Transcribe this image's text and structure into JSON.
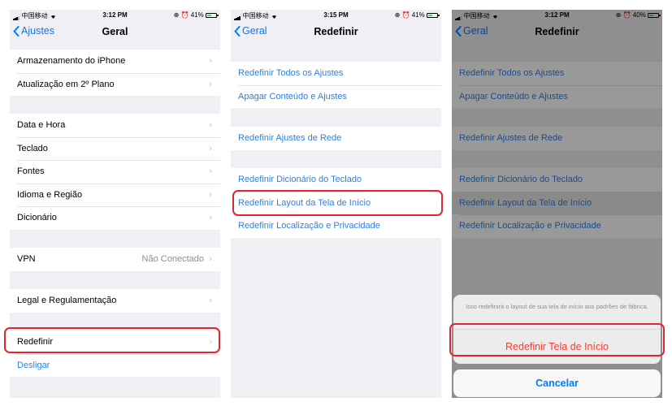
{
  "screen1": {
    "status": {
      "carrier": "中国移动",
      "time": "3:12 PM",
      "battery": "41%"
    },
    "nav": {
      "back_label": "Ajustes",
      "title": "Geral"
    },
    "rows": [
      {
        "label": "Armazenamento do iPhone"
      },
      {
        "label": "Atualização em 2º Plano"
      },
      {
        "label": "Data e Hora"
      },
      {
        "label": "Teclado"
      },
      {
        "label": "Fontes"
      },
      {
        "label": "Idioma e Região"
      },
      {
        "label": "Dicionário"
      },
      {
        "label": "VPN",
        "detail": "Não Conectado"
      },
      {
        "label": "Legal e Regulamentação"
      },
      {
        "label": "Redefinir"
      },
      {
        "label": "Desligar"
      }
    ],
    "chevron": "›"
  },
  "screen2": {
    "status": {
      "carrier": "中国移动",
      "time": "3:15 PM",
      "battery": "41%"
    },
    "nav": {
      "back_label": "Geral",
      "title": "Redefinir"
    },
    "rows": [
      {
        "label": "Redefinir Todos os Ajustes"
      },
      {
        "label": "Apagar Conteúdo e Ajustes"
      },
      {
        "label": "Redefinir Ajustes de Rede"
      },
      {
        "label": "Redefinir Dicionário do Teclado"
      },
      {
        "label": "Redefinir Layout da Tela de Início"
      },
      {
        "label": "Redefinir Localização e Privacidade"
      }
    ]
  },
  "screen3": {
    "status": {
      "carrier": "中国移动",
      "time": "3:12 PM",
      "battery": "40%"
    },
    "nav": {
      "back_label": "Geral",
      "title": "Redefinir"
    },
    "rows": [
      {
        "label": "Redefinir Todos os Ajustes"
      },
      {
        "label": "Apagar Conteúdo e Ajustes"
      },
      {
        "label": "Redefinir Ajustes de Rede"
      },
      {
        "label": "Redefinir Dicionário do Teclado"
      },
      {
        "label": "Redefinir Layout da Tela de Início"
      },
      {
        "label": "Redefinir Localização e Privacidade"
      }
    ],
    "sheet": {
      "message": "Isso redefinirá o layout de sua tela de início aos padrões de fábrica.",
      "confirm_label": "Redefinir Tela de Início",
      "cancel_label": "Cancelar"
    }
  },
  "colors": {
    "accent": "#007aff",
    "destructive": "#ff3b30",
    "highlight": "#e0262e",
    "background": "#efeff4"
  },
  "icons": [
    "signal-icon",
    "wifi-icon",
    "lock-rotation-icon",
    "alarm-icon",
    "battery-icon",
    "back-chevron-icon",
    "chevron-right-icon"
  ]
}
